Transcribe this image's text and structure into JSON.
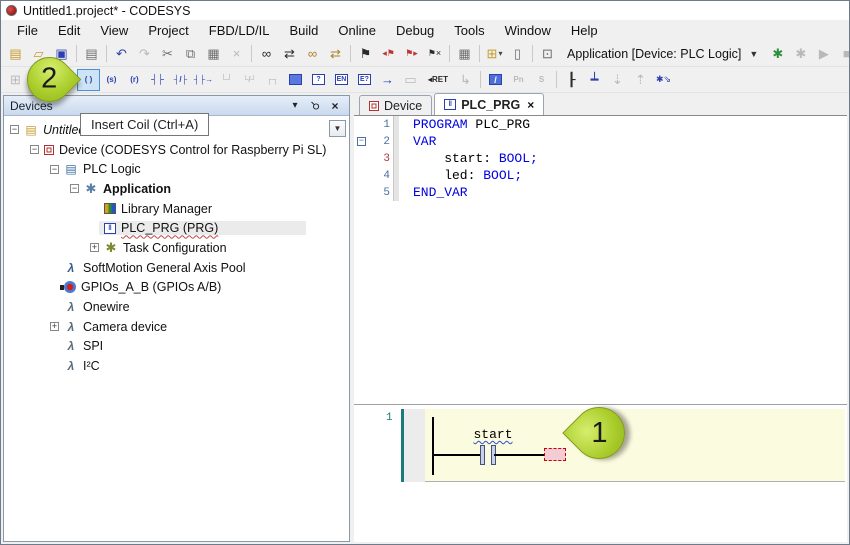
{
  "window": {
    "title": "Untitled1.project* - CODESYS"
  },
  "menu": {
    "items": [
      "File",
      "Edit",
      "View",
      "Project",
      "FBD/LD/IL",
      "Build",
      "Online",
      "Debug",
      "Tools",
      "Window",
      "Help"
    ]
  },
  "toolbar_main": {
    "buttons_left": [
      {
        "name": "new-project",
        "glyph": "▤",
        "cls": "c-gold"
      },
      {
        "name": "open-project",
        "glyph": "▱",
        "cls": "c-gold"
      },
      {
        "name": "save-project",
        "glyph": "▣",
        "cls": "c-blue"
      },
      {
        "sep": true
      },
      {
        "name": "print",
        "glyph": "▤",
        "cls": "c-gray"
      },
      {
        "sep": true
      },
      {
        "name": "undo",
        "glyph": "↶",
        "cls": "c-blue"
      },
      {
        "name": "redo",
        "glyph": "↷",
        "cls": "c-dis"
      },
      {
        "name": "cut",
        "glyph": "✂",
        "cls": "c-gray"
      },
      {
        "name": "copy",
        "glyph": "⧉",
        "cls": "c-gray"
      },
      {
        "name": "paste",
        "glyph": "▦",
        "cls": "c-gray"
      },
      {
        "name": "delete",
        "glyph": "×",
        "cls": "c-dis"
      },
      {
        "sep": true
      },
      {
        "name": "find",
        "glyph": "∞",
        "cls": "c-dark"
      },
      {
        "name": "replace",
        "glyph": "⇄",
        "cls": "c-dark"
      },
      {
        "name": "find-in-project",
        "glyph": "∞",
        "cls": "c-gold2"
      },
      {
        "name": "replace-in-project",
        "glyph": "⇄",
        "cls": "c-gold2"
      },
      {
        "sep": true
      },
      {
        "name": "toggle-bookmark",
        "glyph": "⚑",
        "cls": "c-dark"
      },
      {
        "name": "previous-bookmark",
        "glyph": "◂⚑",
        "cls": "c-red sm"
      },
      {
        "name": "next-bookmark",
        "glyph": "⚑▸",
        "cls": "c-red sm"
      },
      {
        "name": "clear-bookmarks",
        "glyph": "⚑×",
        "cls": "c-dark sm"
      },
      {
        "sep": true
      },
      {
        "name": "paste-special",
        "glyph": "▦",
        "cls": "c-gray"
      },
      {
        "sep": true
      },
      {
        "name": "add-pou",
        "glyph": "⊞",
        "cls": "c-gold",
        "dropdown": true
      },
      {
        "name": "add-object",
        "glyph": "▯",
        "cls": "c-gray"
      },
      {
        "sep": true
      },
      {
        "name": "edit-object",
        "glyph": "⊡",
        "cls": "c-gray"
      }
    ],
    "combo_label": "Application [Device: PLC Logic]",
    "buttons_right": [
      {
        "name": "login",
        "glyph": "✱",
        "cls": "c-green"
      },
      {
        "name": "logout",
        "glyph": "✱",
        "cls": "c-dis"
      },
      {
        "name": "start",
        "glyph": "▶",
        "cls": "c-dis"
      },
      {
        "name": "stop",
        "glyph": "■",
        "cls": "c-dis"
      }
    ]
  },
  "toolbar_ld": {
    "buttons": [
      {
        "name": "insert-network",
        "glyph": "⊞",
        "cls": "c-dis"
      },
      {
        "space": true
      },
      {
        "name": "insert-coil",
        "glyph": "( )",
        "cls": "c-blue xs",
        "state": "hover"
      },
      {
        "name": "insert-set-coil",
        "glyph": "(s)",
        "cls": "c-blue xs"
      },
      {
        "name": "insert-reset-coil",
        "glyph": "(r)",
        "cls": "c-blue xs"
      },
      {
        "name": "insert-contact",
        "glyph": "┤├",
        "cls": "c-blue sm"
      },
      {
        "name": "insert-negated-contact",
        "glyph": "┤/├",
        "cls": "c-blue xs"
      },
      {
        "name": "insert-edge-contact",
        "glyph": "┤├→",
        "cls": "c-blue xs"
      },
      {
        "name": "insert-parallel-contact",
        "glyph": "└┘",
        "cls": "c-dis sm"
      },
      {
        "name": "insert-parallel-negated-contact",
        "glyph": "└/┘",
        "cls": "c-dis xs"
      },
      {
        "name": "insert-parallel-branch",
        "glyph": "┌┐",
        "cls": "c-dis sm"
      },
      {
        "name": "insert-empty-box",
        "box": "",
        "boxcls": "fill"
      },
      {
        "name": "insert-box",
        "box": "?",
        "boxcls": ""
      },
      {
        "name": "insert-box-with-en-eno",
        "box": "EN",
        "boxcls": ""
      },
      {
        "name": "insert-execute",
        "box": "E?",
        "boxcls": ""
      },
      {
        "name": "insert-input",
        "glyph": "→",
        "cls": "c-blue"
      },
      {
        "name": "insert-label",
        "glyph": "▭",
        "cls": "c-dis"
      },
      {
        "name": "insert-return",
        "glyph": "◂RET",
        "cls": "c-dark xs",
        "wide": true
      },
      {
        "name": "insert-jump",
        "glyph": "↳",
        "cls": "c-dis"
      },
      {
        "sep": true
      },
      {
        "name": "toggle-negation",
        "box": "/",
        "boxcls": "solid"
      },
      {
        "name": "edge-detection",
        "glyph": "Pn",
        "cls": "c-dis xs"
      },
      {
        "name": "set-reset",
        "glyph": "S",
        "cls": "c-dis xs"
      },
      {
        "sep": true
      },
      {
        "name": "insert-branch",
        "glyph": "┠",
        "cls": "c-dark"
      },
      {
        "name": "insert-branch-below",
        "glyph": "┷",
        "cls": "c-blue"
      },
      {
        "name": "move-down",
        "glyph": "⇣",
        "cls": "c-dis"
      },
      {
        "name": "move-up",
        "glyph": "⇡",
        "cls": "c-dis"
      },
      {
        "name": "update-parameters",
        "glyph": "✱⇘",
        "cls": "c-blue sm"
      }
    ]
  },
  "tooltip": {
    "text": "Insert Coil (Ctrl+A)"
  },
  "annotations": {
    "step1": "1",
    "step2": "2"
  },
  "devices_panel": {
    "title": "Devices",
    "header_icons": [
      {
        "name": "panel-menu",
        "glyph": "▾"
      },
      {
        "name": "panel-pin",
        "glyph": "⚲"
      },
      {
        "name": "panel-close",
        "glyph": "×"
      }
    ],
    "filter_dropdown_glyph": "▼",
    "tree": [
      {
        "label": "Untitled1",
        "indent": 0,
        "expander": "minus",
        "icon": "project",
        "italic": true
      },
      {
        "label": "Device (CODESYS Control for Raspberry Pi SL)",
        "indent": 1,
        "expander": "minus",
        "icon": "device"
      },
      {
        "label": "PLC Logic",
        "indent": 2,
        "expander": "minus",
        "icon": "plc-logic"
      },
      {
        "label": "Application",
        "indent": 3,
        "expander": "minus",
        "icon": "application",
        "bold": true
      },
      {
        "label": "Library Manager",
        "indent": 4,
        "expander": "none",
        "icon": "library"
      },
      {
        "label": "PLC_PRG (PRG)",
        "indent": 4,
        "expander": "none",
        "icon": "pou",
        "selected": true,
        "wavy": true
      },
      {
        "label": "Task Configuration",
        "indent": 4,
        "expander": "plus",
        "icon": "task"
      },
      {
        "label": "SoftMotion General Axis Pool",
        "indent": 2,
        "expander": "none",
        "icon": "axis-pool"
      },
      {
        "label": "GPIOs_A_B (GPIOs A/B)",
        "indent": 2,
        "expander": "none",
        "icon": "gpio"
      },
      {
        "label": "Onewire",
        "indent": 2,
        "expander": "none",
        "icon": "generic-device"
      },
      {
        "label": "Camera device",
        "indent": 2,
        "expander": "plus",
        "icon": "generic-device"
      },
      {
        "label": "SPI",
        "indent": 2,
        "expander": "none",
        "icon": "generic-device"
      },
      {
        "label": "I²C",
        "indent": 2,
        "expander": "none",
        "icon": "generic-device"
      }
    ]
  },
  "editor": {
    "tabs": [
      {
        "label": "Device",
        "icon": "device",
        "active": false,
        "closable": false
      },
      {
        "label": "PLC_PRG",
        "icon": "pou",
        "active": true,
        "closable": true,
        "close_glyph": "×"
      }
    ],
    "code": {
      "lines": [
        {
          "num": "1",
          "segments": [
            {
              "text": "PROGRAM",
              "type": "keyword"
            },
            {
              "text": " PLC_PRG",
              "type": "plain"
            }
          ]
        },
        {
          "num": "2",
          "fold": "−",
          "segments": [
            {
              "text": "VAR",
              "type": "keyword"
            }
          ]
        },
        {
          "num": "3",
          "modified": true,
          "segments": [
            {
              "text": "    start: ",
              "type": "plain"
            },
            {
              "text": "BOOL;",
              "type": "keyword"
            }
          ]
        },
        {
          "num": "4",
          "segments": [
            {
              "text": "    led: ",
              "type": "plain"
            },
            {
              "text": "BOOL;",
              "type": "keyword"
            }
          ]
        },
        {
          "num": "5",
          "segments": [
            {
              "text": "END_VAR",
              "type": "keyword"
            }
          ]
        }
      ]
    }
  },
  "ladder": {
    "network_number": "1",
    "contact_label": "start"
  }
}
